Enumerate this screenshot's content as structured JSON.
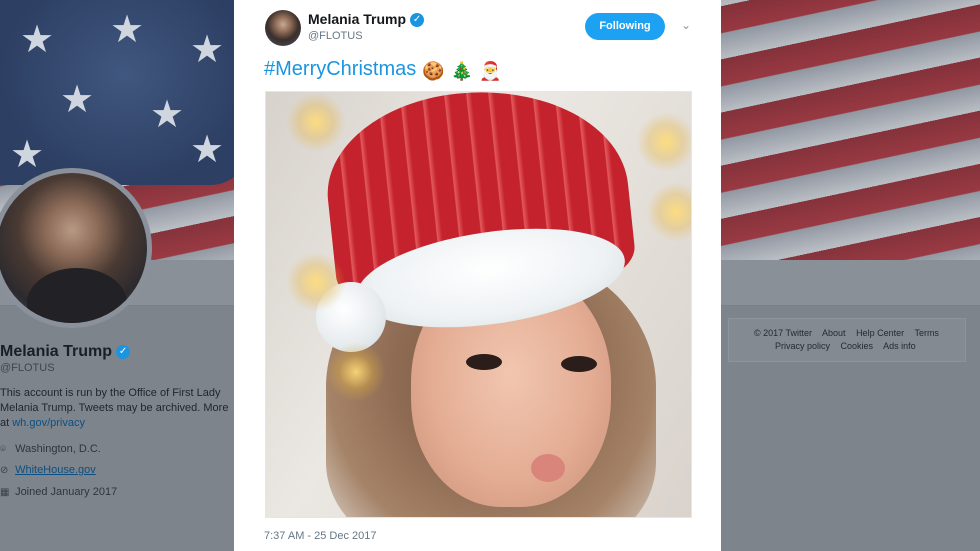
{
  "profile": {
    "name": "Melania Trump",
    "handle": "@FLOTUS",
    "bio": "This account is run by the Office of First Lady Melania Trump. Tweets may be archived. More at ",
    "bio_link": "wh.gov/privacy",
    "location": "Washington, D.C.",
    "website": "WhiteHouse.gov",
    "joined": "Joined January 2017"
  },
  "footer": {
    "items_row1": [
      "© 2017 Twitter",
      "About",
      "Help Center",
      "Terms"
    ],
    "items_row2": [
      "Privacy policy",
      "Cookies",
      "Ads info"
    ]
  },
  "tweet": {
    "author_name": "Melania Trump",
    "author_handle": "@FLOTUS",
    "follow_label": "Following",
    "hashtag": "#MerryChristmas",
    "emojis": [
      "🍪",
      "🎄",
      "🎅"
    ],
    "timestamp": "7:37 AM - 25 Dec 2017"
  },
  "colors": {
    "accent": "#1da1f2",
    "link": "#1b95e0",
    "verified": "#1b95e0"
  },
  "icons": {
    "verified": "verified-badge-icon",
    "location": "location-pin-icon",
    "link": "link-icon",
    "calendar": "calendar-icon",
    "caret": "chevron-down-icon"
  }
}
